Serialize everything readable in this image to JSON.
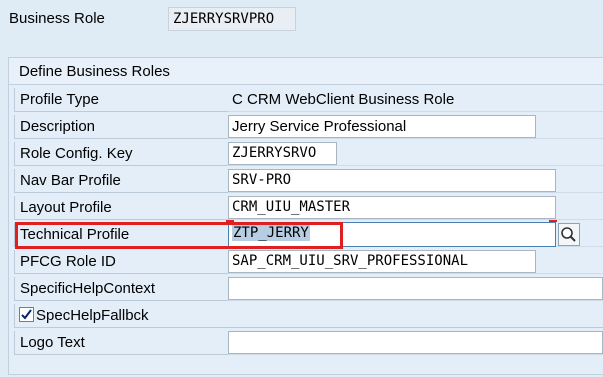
{
  "header": {
    "business_role_label": "Business Role",
    "business_role_value": "ZJERRYSRVPRO"
  },
  "group": {
    "title": "Define Business Roles",
    "profile_type_label": "Profile Type",
    "profile_type_value": "C CRM WebClient Business Role",
    "description_label": "Description",
    "description_value": "Jerry Service Professional",
    "role_config_key_label": "Role Config. Key",
    "role_config_key_value": "ZJERRYSRVO",
    "nav_bar_profile_label": "Nav Bar Profile",
    "nav_bar_profile_value": "SRV-PRO",
    "layout_profile_label": "Layout Profile",
    "layout_profile_value": "CRM_UIU_MASTER",
    "technical_profile_label": "Technical Profile",
    "technical_profile_value": "ZTP_JERRY",
    "pfcg_role_label": "PFCG Role ID",
    "pfcg_role_value": "SAP_CRM_UIU_SRV_PROFESSIONAL",
    "specific_help_label": "SpecificHelpContext",
    "specific_help_value": "",
    "spec_help_fallback_label": "SpecHelpFallbck",
    "spec_help_fallback_checked": true,
    "logo_text_label": "Logo Text",
    "logo_text_value": ""
  },
  "colors": {
    "background": "#dfebf5",
    "highlight_border": "#e02020",
    "selection": "#b7cde3"
  },
  "icons": {
    "search": "search-icon",
    "check": "check-icon"
  }
}
